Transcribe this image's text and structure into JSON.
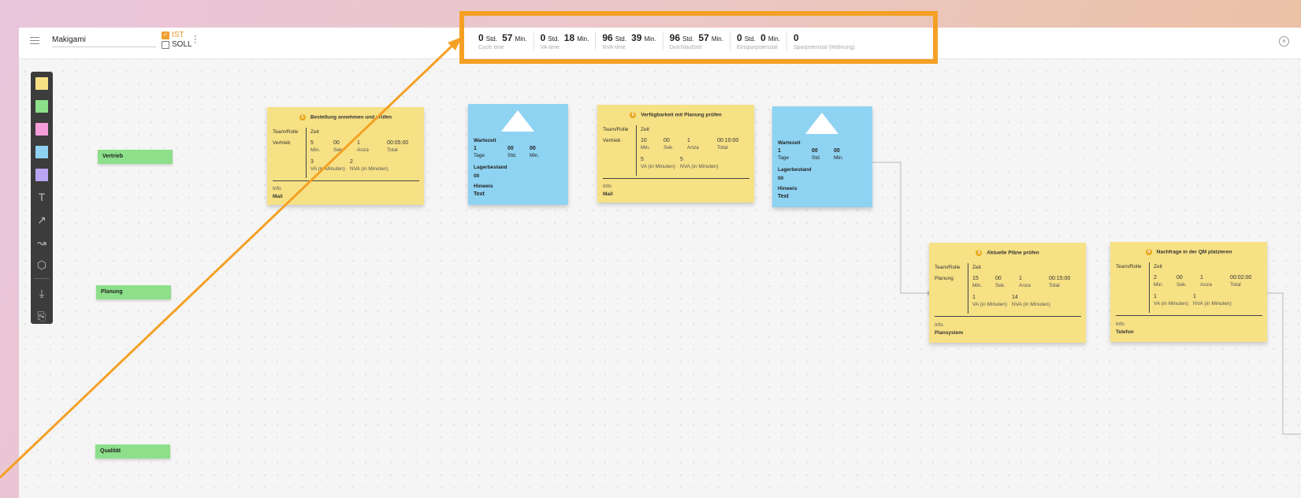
{
  "header": {
    "project_name": "Makigami",
    "ist_label": "IST",
    "soll_label": "SOLL"
  },
  "stats": [
    {
      "h": "0",
      "h_unit": "Std.",
      "m": "57",
      "m_unit": "Min.",
      "caption": "Cycle time"
    },
    {
      "h": "0",
      "h_unit": "Std.",
      "m": "18",
      "m_unit": "Min.",
      "caption": "VA-time"
    },
    {
      "h": "96",
      "h_unit": "Std.",
      "m": "39",
      "m_unit": "Min.",
      "caption": "NVA-time"
    },
    {
      "h": "96",
      "h_unit": "Std.",
      "m": "57",
      "m_unit": "Min.",
      "caption": "Durchlaufzeit"
    },
    {
      "h": "0",
      "h_unit": "Std.",
      "m": "0",
      "m_unit": "Min.",
      "caption": "Einsparpotenzial"
    },
    {
      "h": "0",
      "caption": "Sparpotenzial (Währung)"
    }
  ],
  "toolbar": {
    "swatches": [
      "#f7e185",
      "#8ddf8a",
      "#f59ed9",
      "#8fd3f2",
      "#b9a6f2"
    ],
    "text_tool": "T",
    "line_tool": "↗",
    "trend_tool": "↝",
    "shape_tool": "⬡",
    "download_tool": "⤓",
    "export_tool": "⎘"
  },
  "lanes": [
    "Vertrieb",
    "Planung",
    "Qualität"
  ],
  "process_cards": [
    {
      "num": "1",
      "title": "Bestellung annehmen und prüfen",
      "team_label": "Team/Rolle",
      "team": "Vertrieb",
      "zeit_label": "Zeit",
      "min": "5",
      "sek": "00",
      "anza": "1",
      "total": "00:05:00",
      "va": "3",
      "nva": "2",
      "info_label": "Info",
      "info": "Mail"
    },
    {
      "num": "2",
      "title": "Verfügbarkeit mit Planung prüfen",
      "team_label": "Team/Rolle",
      "team": "Vertrieb",
      "zeit_label": "Zeit",
      "min": "10",
      "sek": "00",
      "anza": "1",
      "total": "00:10:00",
      "va": "5",
      "nva": "5",
      "info_label": "Info",
      "info": "Mail"
    },
    {
      "num": "3",
      "title": "Aktuelle Pläne prüfen",
      "team_label": "Team/Rolle",
      "team": "Planung",
      "zeit_label": "Zeit",
      "min": "15",
      "sek": "00",
      "anza": "1",
      "total": "00:15:00",
      "va": "1",
      "nva": "14",
      "info_label": "Info",
      "info": "Plansystem"
    },
    {
      "num": "4",
      "title": "Nachfrage in der QM platzieren",
      "team_label": "Team/Rolle",
      "team": "",
      "zeit_label": "Zeit",
      "min": "2",
      "sek": "00",
      "anza": "1",
      "total": "00:02:00",
      "va": "1",
      "nva": "1",
      "info_label": "Info",
      "info": "Telefon"
    }
  ],
  "labels": {
    "min": "Min.",
    "sek": "Sek.",
    "anza": "Anza",
    "total": "Total",
    "va": "VA (in Minuten)",
    "nva": "NVA (in Minuten)",
    "std": "Std.",
    "tage": "Tage"
  },
  "wait_cards": [
    {
      "wartezeit_label": "Wartezeit",
      "tage": "1",
      "std": "00",
      "min": "00",
      "lager_label": "Lagerbestand",
      "lager": "00",
      "hinweis_label": "Hinweis",
      "hinweis": "Text"
    },
    {
      "wartezeit_label": "Wartezeit",
      "tage": "1",
      "std": "00",
      "min": "00",
      "lager_label": "Lagerbestand",
      "lager": "00",
      "hinweis_label": "Hinweis",
      "hinweis": "Text"
    }
  ],
  "colors": {
    "highlight": "#f5a024",
    "process_card": "#f7e185",
    "wait_card": "#8fd3f2",
    "lane": "#8ddf8a"
  }
}
